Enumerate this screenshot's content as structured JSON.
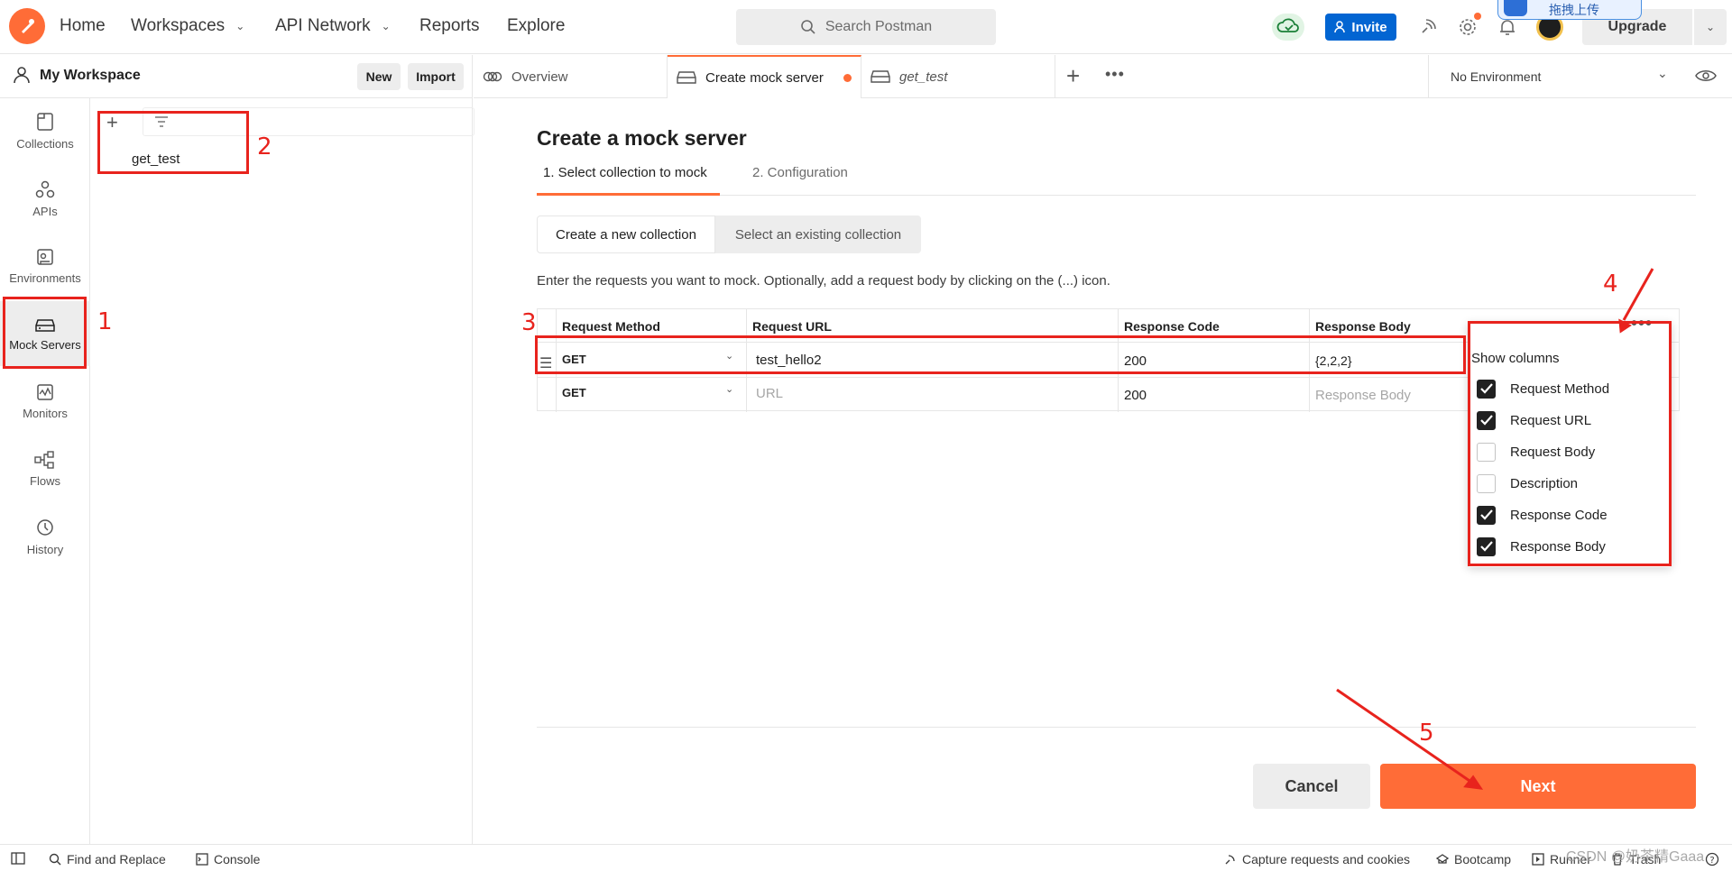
{
  "header": {
    "nav": [
      "Home",
      "Workspaces",
      "API Network",
      "Reports",
      "Explore"
    ],
    "search_placeholder": "Search Postman",
    "invite_label": "Invite",
    "upgrade_label": "Upgrade",
    "upload_popup_label": "拖拽上传"
  },
  "workspace": {
    "title": "My Workspace",
    "new_label": "New",
    "import_label": "Import"
  },
  "rail": [
    {
      "label": "Collections",
      "icon": "collections-icon"
    },
    {
      "label": "APIs",
      "icon": "apis-icon"
    },
    {
      "label": "Environments",
      "icon": "environments-icon"
    },
    {
      "label": "Mock Servers",
      "icon": "mock-servers-icon",
      "active": true
    },
    {
      "label": "Monitors",
      "icon": "monitors-icon"
    },
    {
      "label": "Flows",
      "icon": "flows-icon"
    },
    {
      "label": "History",
      "icon": "history-icon"
    }
  ],
  "panel": {
    "items": [
      "get_test"
    ]
  },
  "tabs": [
    {
      "label": "Overview"
    },
    {
      "label": "Create mock server",
      "active": true,
      "unsaved": true
    },
    {
      "label": "get_test"
    }
  ],
  "environment": {
    "selected": "No Environment"
  },
  "main": {
    "title": "Create a mock server",
    "steps": [
      "1.  Select collection to mock",
      "2.  Configuration"
    ],
    "segments": [
      "Create a new collection",
      "Select an existing collection"
    ],
    "helper": "Enter the requests you want to mock. Optionally, add a request body by clicking on the (...) icon.",
    "columns": [
      "Request Method",
      "Request URL",
      "Response Code",
      "Response Body"
    ],
    "rows": [
      {
        "method": "GET",
        "url": "test_hello2",
        "code": "200",
        "body": "{2,2,2}"
      },
      {
        "method": "GET",
        "url": "",
        "url_placeholder": "URL",
        "code": "200",
        "body": "",
        "body_placeholder": "Response Body"
      }
    ],
    "show_columns": {
      "title": "Show columns",
      "options": [
        {
          "label": "Request Method",
          "checked": true
        },
        {
          "label": "Request URL",
          "checked": true
        },
        {
          "label": "Request Body",
          "checked": false
        },
        {
          "label": "Description",
          "checked": false
        },
        {
          "label": "Response Code",
          "checked": true
        },
        {
          "label": "Response Body",
          "checked": true
        }
      ]
    },
    "cancel_label": "Cancel",
    "next_label": "Next"
  },
  "footer": {
    "find_replace": "Find and Replace",
    "console": "Console",
    "capture": "Capture requests and cookies",
    "bootcamp": "Bootcamp",
    "runner": "Runner",
    "trash": "Trash"
  },
  "watermark": "CSDN @奶茶精Gaaa",
  "annotations": [
    "1",
    "2",
    "3",
    "4",
    "5"
  ],
  "colors": {
    "accent": "#ff6c37",
    "invite": "#0265d2",
    "annotation": "#e8231d"
  }
}
